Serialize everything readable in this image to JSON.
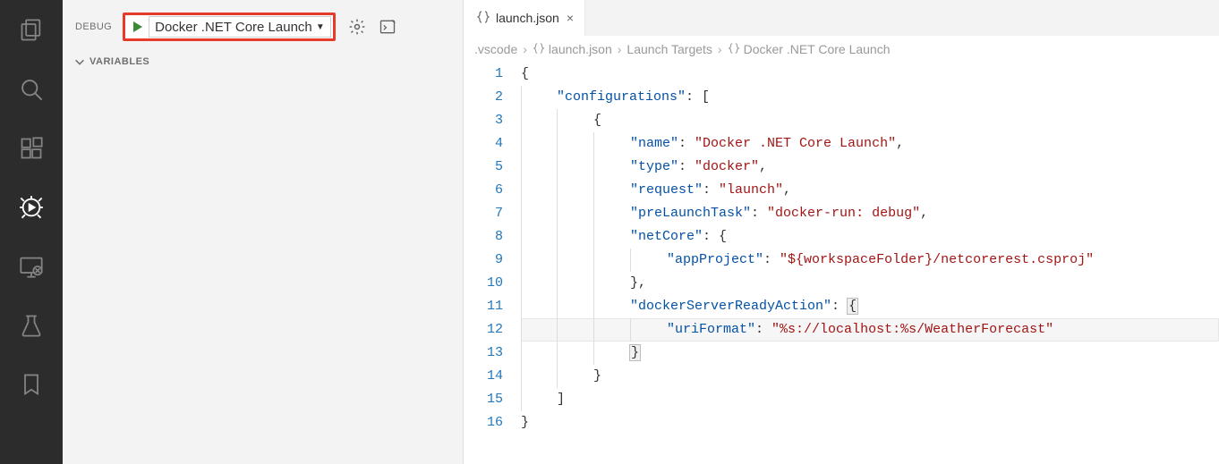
{
  "debug_panel": {
    "title": "DEBUG",
    "selected_config": "Docker .NET Core Launch",
    "sections": {
      "variables_label": "VARIABLES"
    }
  },
  "editor": {
    "tab": {
      "filename": "launch.json",
      "close_glyph": "×"
    },
    "breadcrumb": {
      "items": [
        ".vscode",
        "launch.json",
        "Launch Targets",
        "Docker .NET Core Launch"
      ]
    },
    "gutter_lines": [
      "1",
      "2",
      "3",
      "4",
      "5",
      "6",
      "7",
      "8",
      "9",
      "10",
      "11",
      "12",
      "13",
      "14",
      "15",
      "16"
    ],
    "code": {
      "l2_key": "\"configurations\"",
      "l4_key": "\"name\"",
      "l4_val": "\"Docker .NET Core Launch\"",
      "l5_key": "\"type\"",
      "l5_val": "\"docker\"",
      "l6_key": "\"request\"",
      "l6_val": "\"launch\"",
      "l7_key": "\"preLaunchTask\"",
      "l7_val": "\"docker-run: debug\"",
      "l8_key": "\"netCore\"",
      "l9_key": "\"appProject\"",
      "l9_val": "\"${workspaceFolder}/netcorerest.csproj\"",
      "l11_key": "\"dockerServerReadyAction\"",
      "l12_key": "\"uriFormat\"",
      "l12_val": "\"%s://localhost:%s/WeatherForecast\""
    }
  }
}
